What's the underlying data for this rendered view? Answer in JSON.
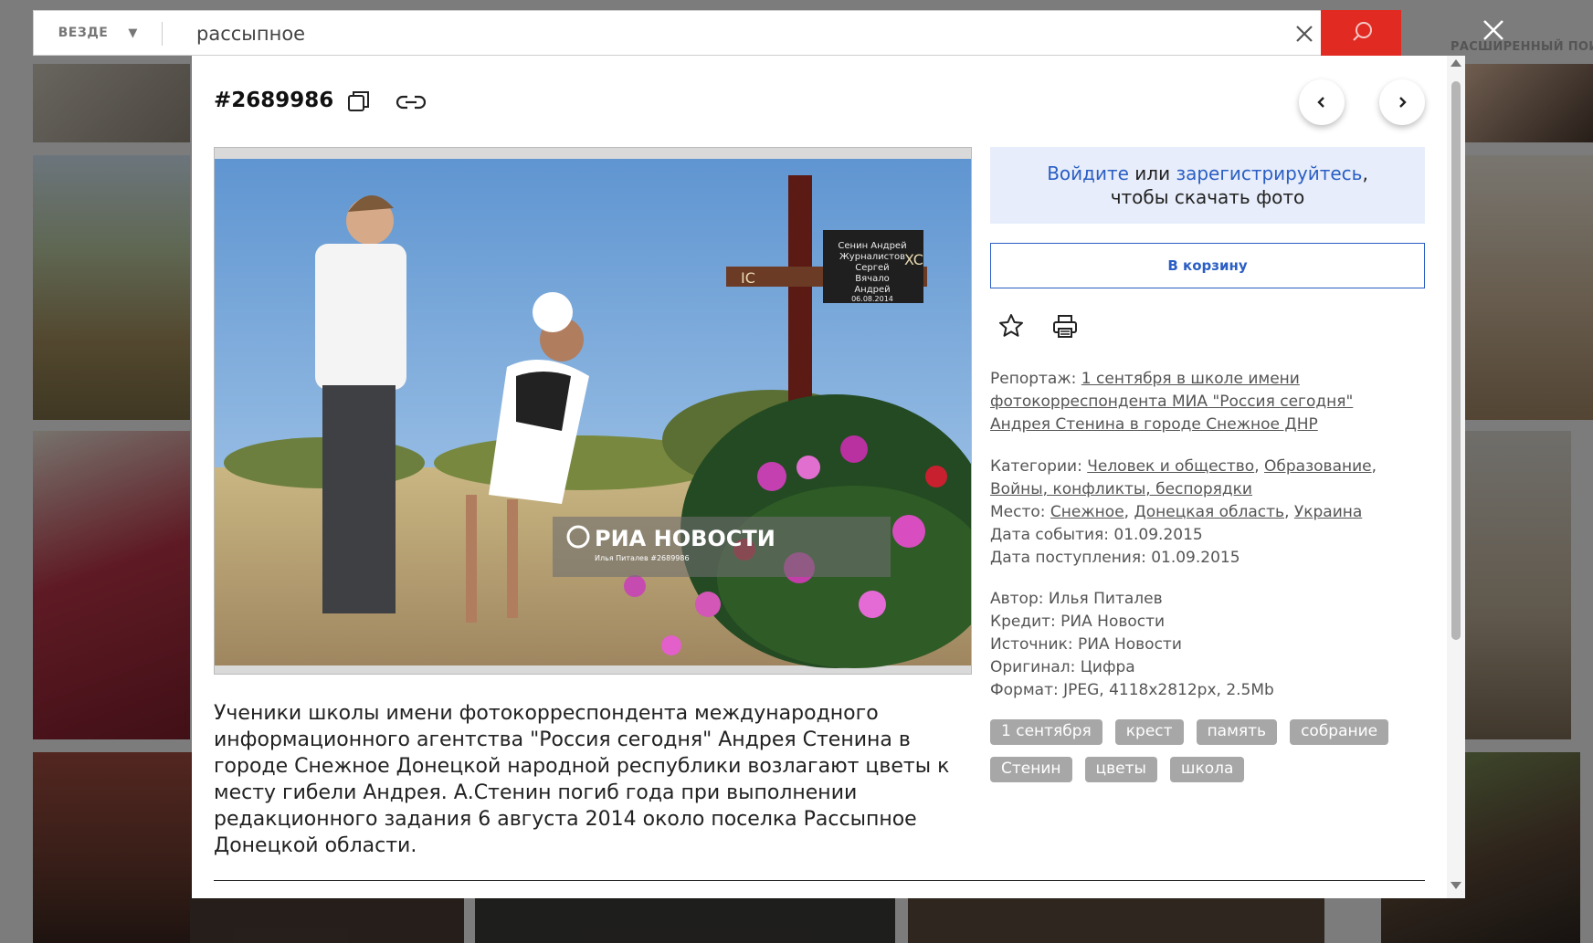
{
  "search": {
    "scope_label": "ВЕЗДЕ",
    "query": "рассыпное"
  },
  "header": {
    "advanced_search": "РАСШИРЕННЫЙ ПОИ"
  },
  "modal": {
    "photo_id": "#2689986",
    "photo_watermark": {
      "brand": "РИА НОВОСТИ",
      "credit": "Илья Питалев #2689986"
    },
    "photo_scene_text": {
      "plaque_lines": [
        "Сенин Андрей",
        "Журналистов",
        "Сергей",
        "Вячало",
        "Андрей",
        "06.08.2014"
      ],
      "cross_letters": [
        "IC",
        "XC"
      ]
    },
    "caption": "Ученики школы имени фотокорреспондента международного информационного агентства \"Россия сегодня\" Андрея Стенина в городе Снежное Донецкой народной республики возлагают цветы к месту гибели Андрея. А.Стенин погиб года при выполнении редакционного задания 6 августа 2014 около поселка Рассыпное Донецкой области.",
    "login": {
      "login_link": "Войдите",
      "or": " или ",
      "register_link": "зарегистрируйтесь",
      "comma": ",",
      "line2": "чтобы скачать фото"
    },
    "cart_button": "В корзину",
    "reportage": {
      "label": "Репортаж: ",
      "lines": [
        "1 сентября в школе имени",
        "фотокорреспондента МИА \"Россия сегодня\"",
        "Андрея Стенина в городе Снежное ДНР"
      ]
    },
    "categories": {
      "label": "Категории: ",
      "items": [
        "Человек и общество",
        "Образование",
        "Войны, конфликты, беспорядки"
      ]
    },
    "place": {
      "label": "Место: ",
      "items": [
        "Снежное",
        "Донецкая область",
        "Украина"
      ]
    },
    "event_date": "Дата события: 01.09.2015",
    "received_date": "Дата поступления: 01.09.2015",
    "author": "Автор: Илья Питалев",
    "credit": "Кредит: РИА Новости",
    "source": "Источник: РИА Новости",
    "original": "Оригинал: Цифра",
    "format": "Формат: JPEG, 4118x2812px, 2.5Mb",
    "tags": [
      "1 сентября",
      "крест",
      "память",
      "собрание",
      "Стенин",
      "цветы",
      "школа"
    ]
  },
  "colors": {
    "accent_red": "#e02a22",
    "link_blue": "#2a5ec4",
    "login_bg": "#e7edfa",
    "tag_bg": "#a7a7a7"
  },
  "icons": [
    "chevron-down-icon",
    "clear-icon",
    "search-icon",
    "close-icon",
    "copy-icon",
    "link-icon",
    "chevron-left-icon",
    "chevron-right-icon",
    "star-icon",
    "printer-icon"
  ]
}
